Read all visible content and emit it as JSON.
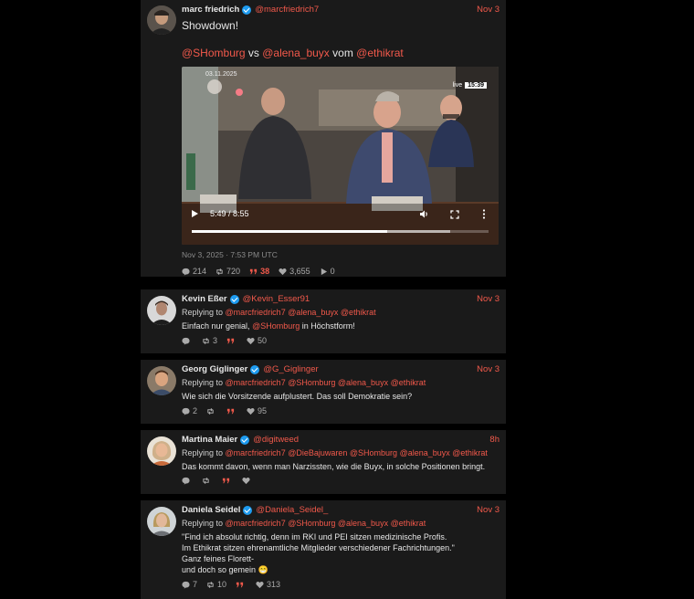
{
  "main_tweet": {
    "name": "marc friedrich",
    "handle": "@marcfriedrich7",
    "date": "Nov 3",
    "line1": "Showdown!",
    "mention1": "@SHomburg",
    "vs": "vs",
    "mention2": "@alena_buyx",
    "vom": "vom",
    "mention3": "@ethikrat",
    "video": {
      "overlay_date": "03.11.2025",
      "live_label": "live",
      "live_time": "15:39",
      "time": "5:49 / 8:55",
      "progress": 0.658,
      "buffered": 0.87
    },
    "timestamp": "Nov 3, 2025 · 7:53 PM UTC",
    "stats": {
      "replies": "214",
      "retweets": "720",
      "quotes": "38",
      "likes": "3,655",
      "views": "0"
    }
  },
  "replies": [
    {
      "name": "Kevin Eßer",
      "handle": "@Kevin_Esser91",
      "date": "Nov 3",
      "replying_label": "Replying to",
      "replying_to": [
        "@marcfriedrich7",
        "@alena_buyx",
        "@ethikrat"
      ],
      "text_pre": "Einfach nur genial, ",
      "text_mention": "@SHomburg",
      "text_post": " in Höchstform!",
      "stats": {
        "replies": "",
        "retweets": "3",
        "quotes": "",
        "likes": "50"
      }
    },
    {
      "name": "Georg Giglinger",
      "handle": "@G_Giglinger",
      "date": "Nov 3",
      "replying_label": "Replying to",
      "replying_to": [
        "@marcfriedrich7",
        "@SHomburg",
        "@alena_buyx",
        "@ethikrat"
      ],
      "text": "Wie sich die Vorsitzende aufplustert. Das soll Demokratie sein?",
      "stats": {
        "replies": "2",
        "retweets": "",
        "quotes": "",
        "likes": "95"
      }
    },
    {
      "name": "Martina Maier",
      "handle": "@digitweed",
      "date": "8h",
      "replying_label": "Replying to",
      "replying_to": [
        "@marcfriedrich7",
        "@DieBajuwaren",
        "@SHomburg",
        "@alena_buyx",
        "@ethikrat"
      ],
      "text": "Das kommt davon, wenn man Narzissten, wie die Buyx, in solche Positionen bringt.",
      "stats": {
        "replies": "",
        "retweets": "",
        "quotes": "",
        "likes": ""
      }
    },
    {
      "name": "Daniela Seidel",
      "handle": "@Daniela_Seidel_",
      "date": "Nov 3",
      "replying_label": "Replying to",
      "replying_to": [
        "@marcfriedrich7",
        "@SHomburg",
        "@alena_buyx",
        "@ethikrat"
      ],
      "lines": [
        "\"Find ich absolut richtig, denn im RKI und PEI sitzen medizinische Profis.",
        "Im Ethikrat sitzen ehrenamtliche Mitglieder verschiedener Fachrichtungen.\"",
        "Ganz feines Florett-",
        "und doch so gemein 😁"
      ],
      "stats": {
        "replies": "7",
        "retweets": "10",
        "quotes": "",
        "likes": "313"
      }
    }
  ],
  "colors": {
    "accent": "#f2594b",
    "verified": "#1d9bf0",
    "card": "#1a1a1a"
  }
}
